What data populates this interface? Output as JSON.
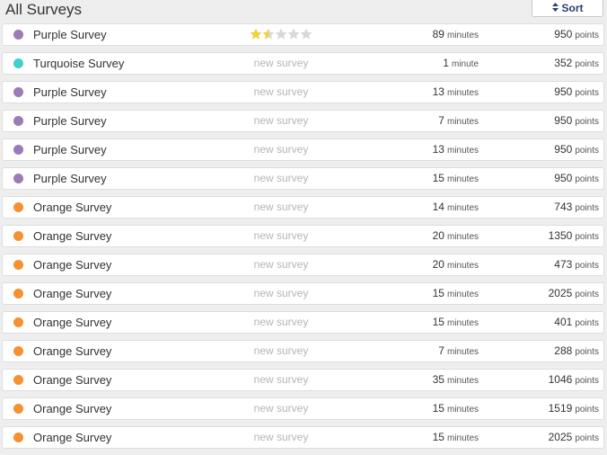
{
  "header": {
    "title": "All Surveys",
    "sort_label": "Sort",
    "sort_icon": "sort-updown-icon"
  },
  "colors": {
    "purple": "#9b7bb8",
    "turquoise": "#41d0c9",
    "orange": "#f59133",
    "star_filled": "#f2d23a",
    "star_empty": "#d8d8d8"
  },
  "rating_max": 5,
  "surveys": [
    {
      "name": "Purple Survey",
      "color": "purple",
      "status": "",
      "rating": 1.5,
      "minutes": "89",
      "minutes_unit": "minutes",
      "points": "950",
      "points_unit": "points"
    },
    {
      "name": "Turquoise Survey",
      "color": "turquoise",
      "status": "new survey",
      "minutes": "1",
      "minutes_unit": "minute",
      "points": "352",
      "points_unit": "points"
    },
    {
      "name": "Purple Survey",
      "color": "purple",
      "status": "new survey",
      "minutes": "13",
      "minutes_unit": "minutes",
      "points": "950",
      "points_unit": "points"
    },
    {
      "name": "Purple Survey",
      "color": "purple",
      "status": "new survey",
      "minutes": "7",
      "minutes_unit": "minutes",
      "points": "950",
      "points_unit": "points"
    },
    {
      "name": "Purple Survey",
      "color": "purple",
      "status": "new survey",
      "minutes": "13",
      "minutes_unit": "minutes",
      "points": "950",
      "points_unit": "points"
    },
    {
      "name": "Purple Survey",
      "color": "purple",
      "status": "new survey",
      "minutes": "15",
      "minutes_unit": "minutes",
      "points": "950",
      "points_unit": "points"
    },
    {
      "name": "Orange Survey",
      "color": "orange",
      "status": "new survey",
      "minutes": "14",
      "minutes_unit": "minutes",
      "points": "743",
      "points_unit": "points"
    },
    {
      "name": "Orange Survey",
      "color": "orange",
      "status": "new survey",
      "minutes": "20",
      "minutes_unit": "minutes",
      "points": "1350",
      "points_unit": "points"
    },
    {
      "name": "Orange Survey",
      "color": "orange",
      "status": "new survey",
      "minutes": "20",
      "minutes_unit": "minutes",
      "points": "473",
      "points_unit": "points"
    },
    {
      "name": "Orange Survey",
      "color": "orange",
      "status": "new survey",
      "minutes": "15",
      "minutes_unit": "minutes",
      "points": "2025",
      "points_unit": "points"
    },
    {
      "name": "Orange Survey",
      "color": "orange",
      "status": "new survey",
      "minutes": "15",
      "minutes_unit": "minutes",
      "points": "401",
      "points_unit": "points"
    },
    {
      "name": "Orange Survey",
      "color": "orange",
      "status": "new survey",
      "minutes": "7",
      "minutes_unit": "minutes",
      "points": "288",
      "points_unit": "points"
    },
    {
      "name": "Orange Survey",
      "color": "orange",
      "status": "new survey",
      "minutes": "35",
      "minutes_unit": "minutes",
      "points": "1046",
      "points_unit": "points"
    },
    {
      "name": "Orange Survey",
      "color": "orange",
      "status": "new survey",
      "minutes": "15",
      "minutes_unit": "minutes",
      "points": "1519",
      "points_unit": "points"
    },
    {
      "name": "Orange Survey",
      "color": "orange",
      "status": "new survey",
      "minutes": "15",
      "minutes_unit": "minutes",
      "points": "2025",
      "points_unit": "points"
    }
  ]
}
